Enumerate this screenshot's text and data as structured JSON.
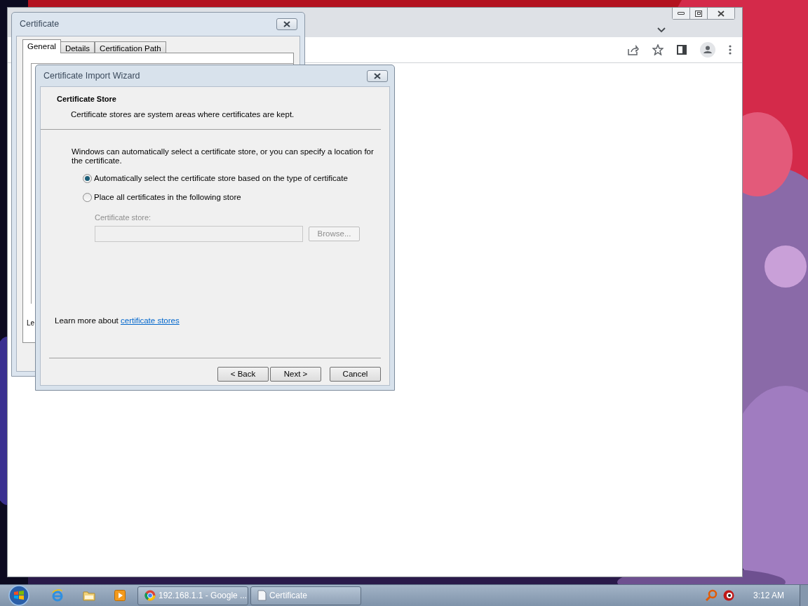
{
  "certificate_dialog": {
    "title": "Certificate",
    "tabs": [
      {
        "label": "General",
        "selected": true
      },
      {
        "label": "Details",
        "selected": false
      },
      {
        "label": "Certification Path",
        "selected": false
      }
    ],
    "partial_text": "Le"
  },
  "wizard": {
    "title": "Certificate Import Wizard",
    "heading": "Certificate Store",
    "subheading": "Certificate stores are system areas where certificates are kept.",
    "description": "Windows can automatically select a certificate store, or you can specify a location for the certificate.",
    "options": [
      {
        "label": "Automatically select the certificate store based on the type of certificate",
        "selected": true
      },
      {
        "label": "Place all certificates in the following store",
        "selected": false
      }
    ],
    "store_label": "Certificate store:",
    "store_field": {
      "disabled": true
    },
    "browse_button": {
      "label": "Browse...",
      "disabled": true
    },
    "learn_more": {
      "text": "Learn more about",
      "link": "certificate stores"
    },
    "buttons": [
      "< Back",
      "Next >",
      "Cancel"
    ]
  },
  "taskbar": {
    "tasks": [
      {
        "label": "192.168.1.1 - Google ...",
        "kind": "browser"
      },
      {
        "label": "Certificate",
        "kind": "document"
      }
    ],
    "clock": "3:12 AM"
  }
}
